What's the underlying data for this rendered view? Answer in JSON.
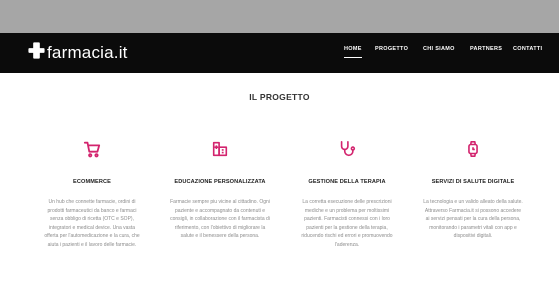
{
  "brand": {
    "name": "farmacia.it",
    "icon": "cross-plus-icon"
  },
  "nav": {
    "items": [
      {
        "label": "HOME",
        "active": true
      },
      {
        "label": "PROGETTO",
        "active": false
      },
      {
        "label": "CHI SIAMO",
        "active": false
      },
      {
        "label": "PARTNERS",
        "active": false
      },
      {
        "label": "CONTATTI",
        "active": false
      }
    ]
  },
  "section": {
    "title": "IL PROGETTO"
  },
  "features": [
    {
      "icon": "cart-icon",
      "title": "ECOMMERCE",
      "text": "Un hub che connette farmacie, ordini di prodotti farmaceutici da banco e farmaci senza obbligo di ricetta (OTC e SOP), integratori e medical device. Una vasta offerta per l'automedicazione e la cura, che aiuta i pazienti e il lavoro delle farmacie."
    },
    {
      "icon": "clinic-icon",
      "title": "EDUCAZIONE PERSONALIZZATA",
      "text": "Farmacie sempre piu vicine al cittadino. Ogni paziente e accompagnato da contenuti e consigli, in collaborazione con il farmacista di riferimento, con l'obiettivo di migliorare la salute e il benessere della persona."
    },
    {
      "icon": "stethoscope-icon",
      "title": "GESTIONE DELLA TERAPIA",
      "text": "La corretta esecuzione delle prescrizioni mediche e un problema per moltissimi pazienti. Farmacisti connessi con i loro pazienti per la gestione della terapia, riducendo rischi ed errori e promuovendo l'aderenza."
    },
    {
      "icon": "smartwatch-icon",
      "title": "SERVIZI DI SALUTE DIGITALE",
      "text": "La tecnologia e un valido alleato della salute. Attraverso Farmacia.it si possono accedere ai servizi pensati per la cura della persona, monitorando i parametri vitali con app e dispositivi digitali."
    }
  ],
  "colors": {
    "accent": "#d3246e",
    "navbar": "#0b0b0b",
    "topbar": "#a6a6a6"
  }
}
